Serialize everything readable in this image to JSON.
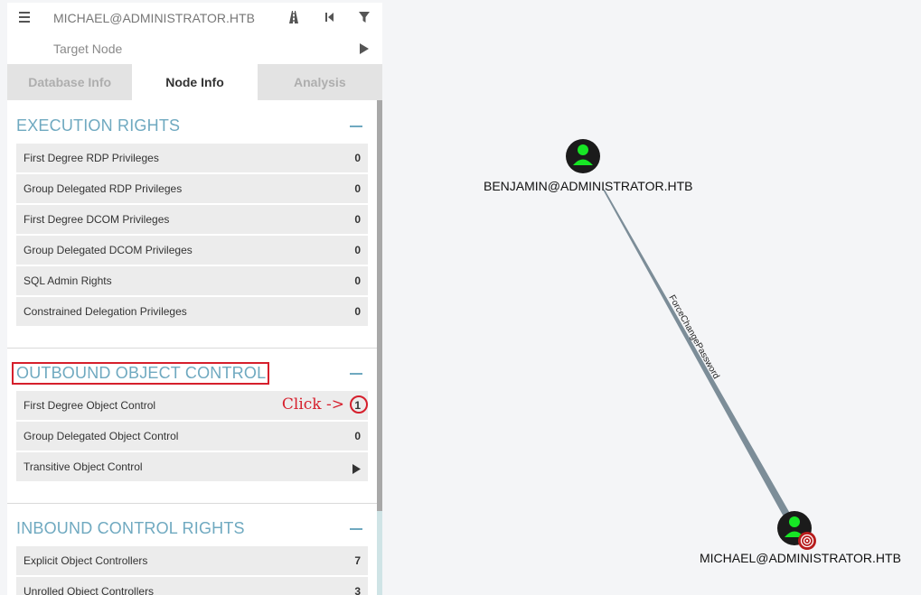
{
  "search": {
    "start_value": "MICHAEL@ADMINISTRATOR.HTB",
    "target_placeholder": "Target Node",
    "icons": [
      "menu-icon",
      "pathfinding-icon",
      "back-icon",
      "filter-icon",
      "play-icon"
    ]
  },
  "tabs": [
    {
      "label": "Database Info",
      "active": false
    },
    {
      "label": "Node Info",
      "active": true
    },
    {
      "label": "Analysis",
      "active": false
    }
  ],
  "sections": {
    "execution": {
      "title": "EXECUTION RIGHTS",
      "rows": [
        {
          "label": "First Degree RDP Privileges",
          "value": "0"
        },
        {
          "label": "Group Delegated RDP Privileges",
          "value": "0"
        },
        {
          "label": "First Degree DCOM Privileges",
          "value": "0"
        },
        {
          "label": "Group Delegated DCOM Privileges",
          "value": "0"
        },
        {
          "label": "SQL Admin Rights",
          "value": "0"
        },
        {
          "label": "Constrained Delegation Privileges",
          "value": "0"
        }
      ]
    },
    "outbound": {
      "title": "OUTBOUND OBJECT CONTROL",
      "annotation": "Click ->",
      "rows": [
        {
          "label": "First Degree Object Control",
          "value": "1"
        },
        {
          "label": "Group Delegated Object Control",
          "value": "0"
        },
        {
          "label": "Transitive Object Control",
          "value": ""
        }
      ]
    },
    "inbound": {
      "title": "INBOUND CONTROL RIGHTS",
      "rows": [
        {
          "label": "Explicit Object Controllers",
          "value": "7"
        },
        {
          "label": "Unrolled Object Controllers",
          "value": "3"
        }
      ]
    }
  },
  "graph": {
    "nodes": [
      {
        "label": "BENJAMIN@ADMINISTRATOR.HTB",
        "type": "user-icon"
      },
      {
        "label": "MICHAEL@ADMINISTRATOR.HTB",
        "type": "user-icon",
        "target": true
      }
    ],
    "edge_label": "ForceChangePassword",
    "colors": {
      "node": "#1b1b1b",
      "user": "#17e625",
      "edge": "#7c8d98",
      "target": "#b71c1c",
      "accent": "#6fa9c0",
      "annotation": "#d61f2c"
    }
  }
}
